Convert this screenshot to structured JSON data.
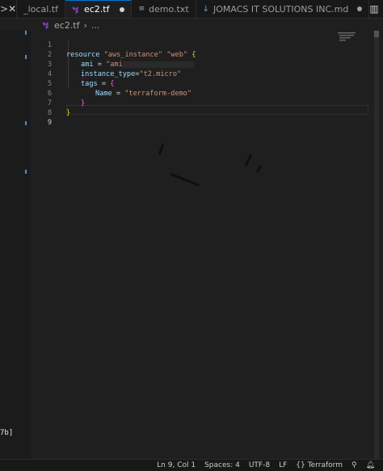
{
  "tabs": [
    {
      "label": "_local.tf",
      "active": false,
      "dirty": false
    },
    {
      "label": "ec2.tf",
      "active": true,
      "dirty": true
    },
    {
      "label": "demo.txt",
      "active": false,
      "dirty": false
    },
    {
      "label": "JOMACS IT SOLUTIONS INC.md",
      "active": false,
      "dirty": true
    }
  ],
  "breadcrumb": {
    "file": "ec2.tf",
    "separator": "›",
    "path": "..."
  },
  "code_lines": [
    {
      "n": "1",
      "text": "resource \"aws_instance\" \"web\" {"
    },
    {
      "n": "2",
      "text": "ami = \"ami"
    },
    {
      "n": "3",
      "text": "instance_type=\"t2.micro\""
    },
    {
      "n": "4",
      "text": "tags = {"
    },
    {
      "n": "5",
      "text": "Name = \"terraform-demo\""
    },
    {
      "n": "6",
      "text": "}"
    },
    {
      "n": "7",
      "text": "}"
    },
    {
      "n": "8",
      "text": ""
    },
    {
      "n": "9",
      "text": ""
    }
  ],
  "code": {
    "l1_kw": "resource",
    "l1_s1": "\"aws_instance\"",
    "l1_s2": "\"web\"",
    "l1_brace": "{",
    "l2_key": "ami",
    "l2_eq": " = ",
    "l2_str": "\"ami",
    "l3_key": "instance_type",
    "l3_eq": "=",
    "l3_str": "\"t2.micro\"",
    "l4_key": "tags",
    "l4_eq": " = ",
    "l4_brace": "{",
    "l5_key": "Name",
    "l5_eq": " = ",
    "l5_str": "\"terraform-demo\"",
    "l6": "}",
    "l7": "}"
  },
  "sidebar_fragment": "7b]",
  "status": {
    "position": "Ln 9, Col 1",
    "spaces": "Spaces: 4",
    "encoding": "UTF-8",
    "eol": "LF",
    "language_icon": "{}",
    "language": "Terraform"
  },
  "colors": {
    "accent": "#0078d4",
    "terraform": "#7b42bc",
    "string": "#ce9178",
    "key": "#9cdcfe",
    "brace": "#ffd700"
  }
}
